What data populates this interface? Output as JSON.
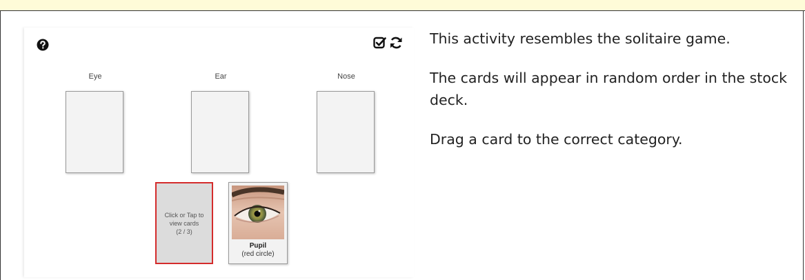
{
  "activity": {
    "categories": [
      "Eye",
      "Ear",
      "Nose"
    ],
    "stock": {
      "line1": "Click or Tap to",
      "line2": "view cards",
      "line3": "(2 / 3)"
    },
    "card": {
      "title": "Pupil",
      "subtitle": "(red circle)"
    },
    "icons": {
      "help": "question-circle",
      "check": "check-square",
      "refresh": "refresh"
    }
  },
  "instructions": [
    "This activity resembles the solitaire game.",
    "The cards will appear in random order in the stock deck.",
    "Drag a card to the correct category."
  ],
  "colors": {
    "top_band": "#fefbd8",
    "stock_border": "#d42b2b"
  }
}
